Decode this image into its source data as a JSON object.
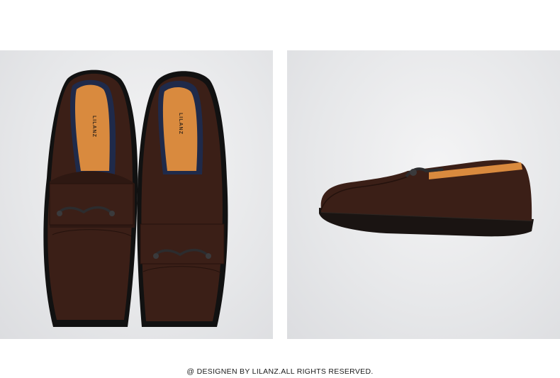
{
  "footer": {
    "copyright": "@ DESIGNEN BY LILANZ.ALL RIGHTS RESERVED."
  },
  "photos": [
    {
      "name": "loafers-top-view",
      "insole_logo": "LILANZ"
    },
    {
      "name": "loafer-side-view"
    }
  ],
  "colors": {
    "background": "#e6e7e9",
    "suede": "#3b1f17",
    "suede_dark": "#24120d",
    "insole": "#d98a3e",
    "lining": "#1f2a4a",
    "hardware": "#2c2c2e",
    "sole": "#1a1412"
  }
}
